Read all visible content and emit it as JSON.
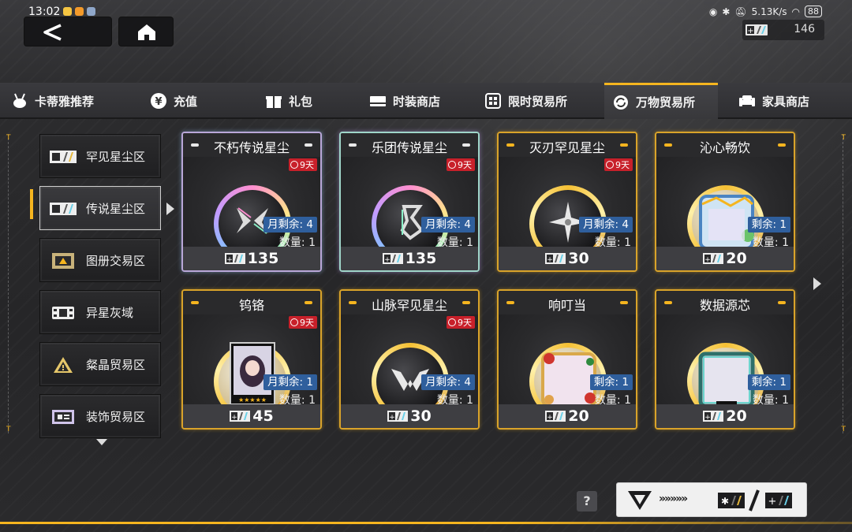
{
  "status_bar": {
    "time": "13:02",
    "network_speed": "5.13K/s",
    "battery": "88"
  },
  "currency": {
    "amount": "146"
  },
  "tabs": [
    {
      "label": "卡蒂雅推荐",
      "icon": "bunny-icon"
    },
    {
      "label": "充值",
      "icon": "yen-icon"
    },
    {
      "label": "礼包",
      "icon": "gift-icon"
    },
    {
      "label": "时装商店",
      "icon": "card-icon"
    },
    {
      "label": "限时贸易所",
      "icon": "grid-icon"
    },
    {
      "label": "万物贸易所",
      "icon": "refresh-icon",
      "active": true
    },
    {
      "label": "家具商店",
      "icon": "chair-icon"
    }
  ],
  "sidebar": {
    "items": [
      {
        "label": "罕见星尘区",
        "icon": "stardust-ticket-icon"
      },
      {
        "label": "传说星尘区",
        "icon": "stardust-ticket-icon",
        "active": true
      },
      {
        "label": "图册交易区",
        "icon": "album-icon"
      },
      {
        "label": "异星灰域",
        "icon": "film-icon"
      },
      {
        "label": "粲晶贸易区",
        "icon": "warning-triangle-icon"
      },
      {
        "label": "装饰贸易区",
        "icon": "decor-card-icon"
      }
    ]
  },
  "items": [
    {
      "title": "不朽传说星尘",
      "badge": "9天",
      "remain_label": "月剩余: 4",
      "qty_label": "数量: 1",
      "price": "135",
      "style": "rainbow"
    },
    {
      "title": "乐团传说星尘",
      "badge": "9天",
      "remain_label": "月剩余: 4",
      "qty_label": "数量: 1",
      "price": "135",
      "style": "rainbow2"
    },
    {
      "title": "灭刃罕见星尘",
      "badge": "9天",
      "remain_label": "月剩余: 4",
      "qty_label": "数量: 1",
      "price": "30",
      "style": "gold"
    },
    {
      "title": "沁心畅饮",
      "badge": "",
      "remain_label": "剩余: 1",
      "qty_label": "数量: 1",
      "price": "20",
      "style": "gold"
    },
    {
      "title": "钨铬",
      "badge": "9天",
      "remain_label": "月剩余: 1",
      "qty_label": "数量: 1",
      "price": "45",
      "style": "gold"
    },
    {
      "title": "山脉罕见星尘",
      "badge": "9天",
      "remain_label": "月剩余: 4",
      "qty_label": "数量: 1",
      "price": "30",
      "style": "gold"
    },
    {
      "title": "响叮当",
      "badge": "",
      "remain_label": "剩余: 1",
      "qty_label": "数量: 1",
      "price": "20",
      "style": "gold"
    },
    {
      "title": "数据源芯",
      "badge": "",
      "remain_label": "剩余: 1",
      "qty_label": "数量: 1",
      "price": "20",
      "style": "gold"
    }
  ],
  "help": {
    "label": "?"
  },
  "exchange": {
    "chevrons": "»»»»»"
  },
  "colors": {
    "accent": "#f5b51f",
    "badge_red": "#c8202a",
    "remain_blue": "#2f5f9d"
  }
}
